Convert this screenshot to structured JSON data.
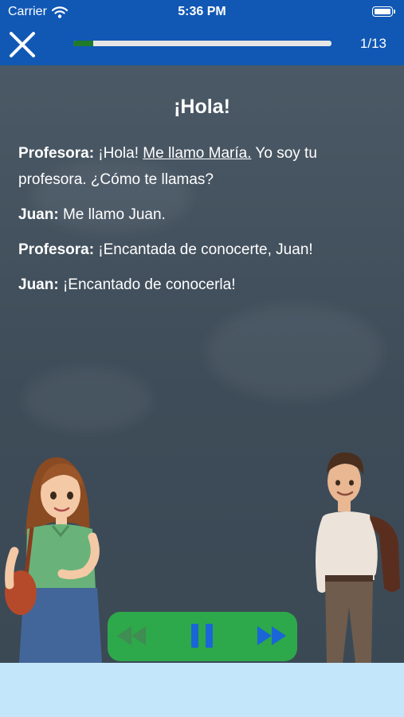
{
  "status_bar": {
    "carrier": "Carrier",
    "time": "5:36 PM"
  },
  "header": {
    "page_counter": "1/13",
    "progress_fraction": 0.077,
    "progress_color": "#1f7a2a",
    "accent": "#1158b4"
  },
  "lesson": {
    "title": "¡Hola!",
    "lines": [
      {
        "speaker": "Profesora:",
        "pre": " ¡Hola! ",
        "highlight": "Me llamo María.",
        "post": " Yo soy tu profesora. ¿Cómo te llamas?"
      },
      {
        "speaker": "Juan:",
        "text": " Me llamo Juan."
      },
      {
        "speaker": "Profesora:",
        "text": " ¡Encantada de conocerte, Juan!"
      },
      {
        "speaker": "Juan:",
        "text": " ¡Encantado de conocerla!"
      }
    ]
  },
  "player": {
    "state": "playing",
    "background": "#2da84a",
    "icons": [
      "rewind-icon",
      "pause-icon",
      "fast-forward-icon"
    ]
  }
}
